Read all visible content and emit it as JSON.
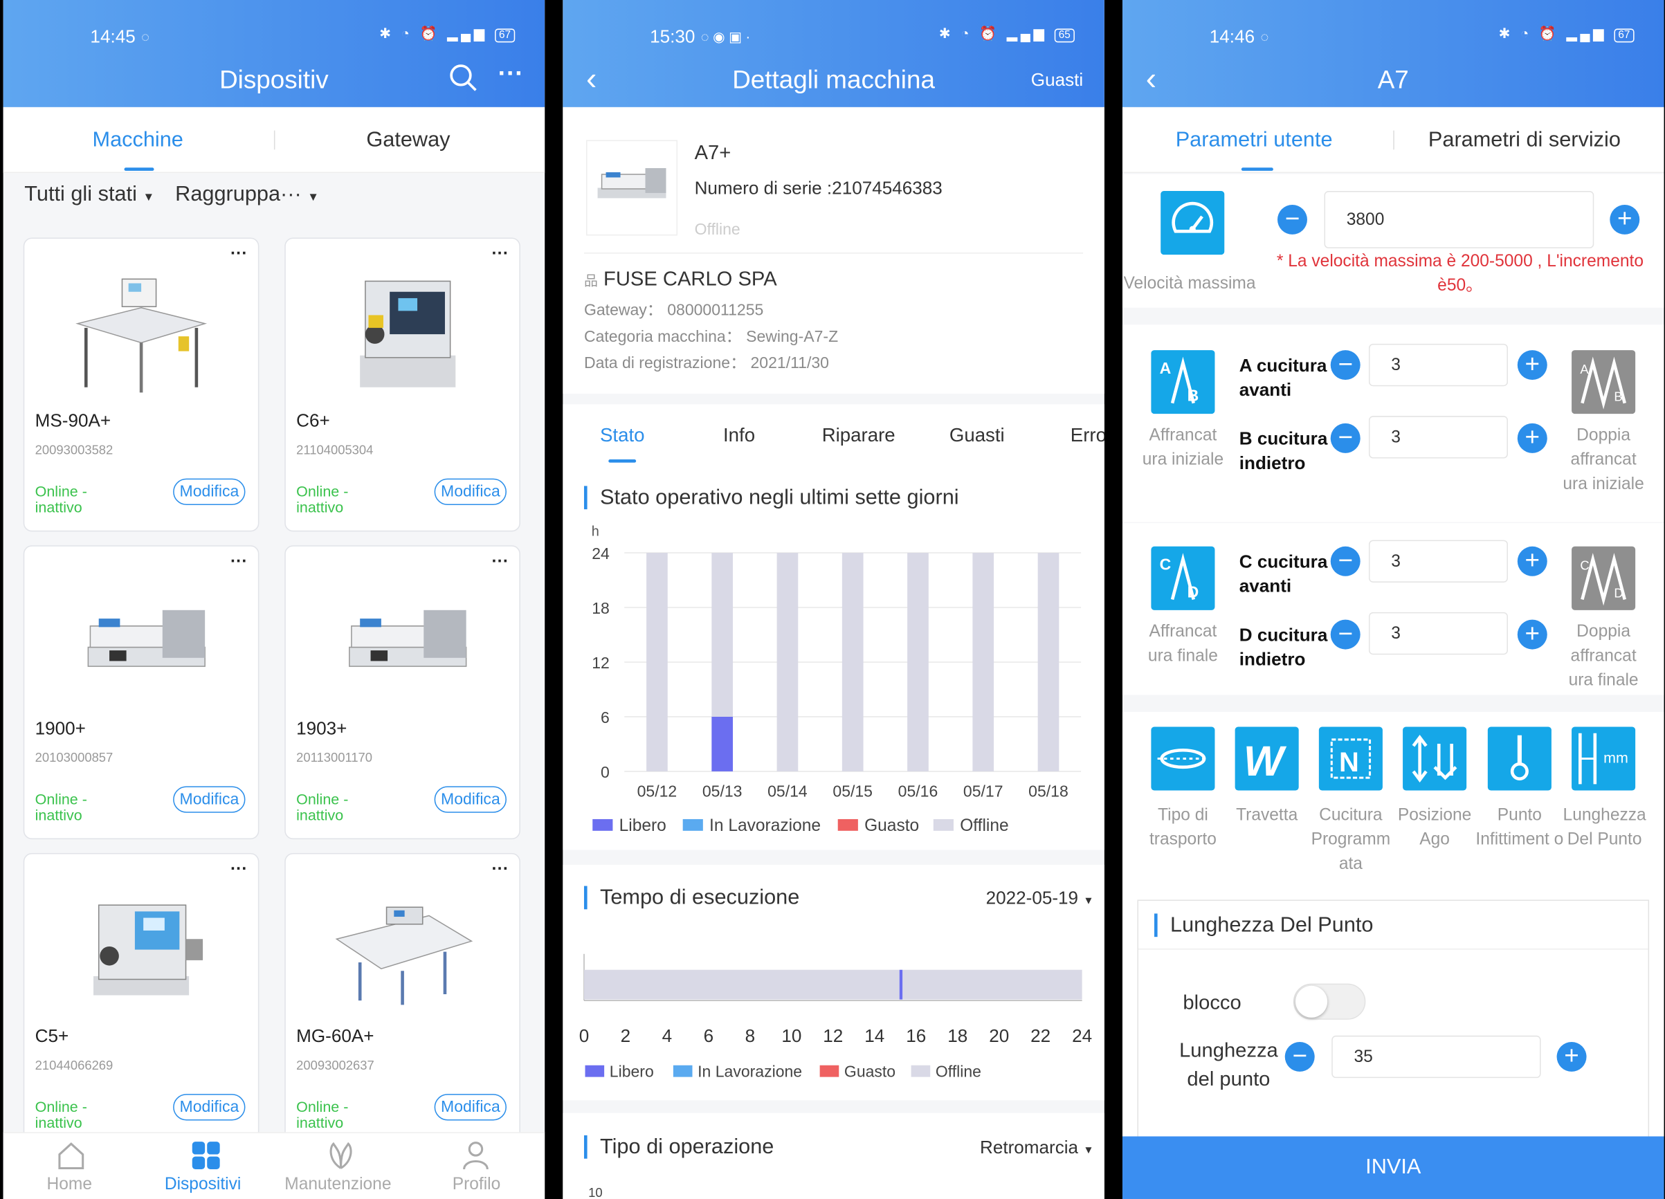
{
  "p1": {
    "time": "14:45",
    "battery": "67",
    "title": "Dispositiv",
    "tabs": [
      "Macchine",
      "Gateway"
    ],
    "filters": [
      "Tutti gli stati",
      "Raggruppa···"
    ],
    "cards": [
      {
        "name": "MS-90A+",
        "serial": "20093003582",
        "status": "Online - inattivo",
        "edit": "Modifica"
      },
      {
        "name": "C6+",
        "serial": "21104005304",
        "status": "Online - inattivo",
        "edit": "Modifica"
      },
      {
        "name": "1900+",
        "serial": "20103000857",
        "status": "Online - inattivo",
        "edit": "Modifica"
      },
      {
        "name": "1903+",
        "serial": "20113001170",
        "status": "Online - inattivo",
        "edit": "Modifica"
      },
      {
        "name": "C5+",
        "serial": "21044066269",
        "status": "Online - inattivo",
        "edit": "Modifica"
      },
      {
        "name": "MG-60A+",
        "serial": "20093002637",
        "status": "Online - inattivo",
        "edit": "Modifica"
      }
    ],
    "nav": [
      "Home",
      "Dispositivi",
      "Manutenzione",
      "Profilo"
    ]
  },
  "p2": {
    "time": "15:30",
    "battery": "65",
    "title": "Dettagli macchina",
    "right": "Guasti",
    "model": "A7+",
    "serial": "Numero di serie :21074546383",
    "state": "Offline",
    "company": "FUSE CARLO SPA",
    "gateway": "Gateway： 08000011255",
    "category": "Categoria macchina： Sewing-A7-Z",
    "regdate": "Data di registrazione： 2021/11/30",
    "tabs": [
      "Stato",
      "Info",
      "Riparare",
      "Guasti",
      "Erro"
    ],
    "sec1": "Stato operativo negli ultimi sette giorni",
    "sec2": "Tempo di esecuzione",
    "date": "2022-05-19",
    "sec3": "Tipo di operazione",
    "optype": "Retromarcia",
    "bottom_tick": "10",
    "legend": [
      "Libero",
      "In Lavorazione",
      "Guasto",
      "Offline"
    ],
    "colors": {
      "libero": "#6b6ef0",
      "lavorazione": "#5aaaf0",
      "guasto": "#ef6161",
      "offline": "#d9d9e6"
    }
  },
  "chart_data": [
    {
      "type": "bar",
      "ylabel": "h",
      "ylim": [
        0,
        24
      ],
      "yticks": [
        "0",
        "6",
        "12",
        "18",
        "24"
      ],
      "categories": [
        "05/12",
        "05/13",
        "05/14",
        "05/15",
        "05/16",
        "05/17",
        "05/18"
      ],
      "series": [
        {
          "name": "Libero",
          "values": [
            0,
            6,
            0,
            0,
            0,
            0,
            0
          ]
        },
        {
          "name": "In Lavorazione",
          "values": [
            0,
            0,
            0,
            0,
            0,
            0,
            0
          ]
        },
        {
          "name": "Guasto",
          "values": [
            0,
            0,
            0,
            0,
            0,
            0,
            0
          ]
        },
        {
          "name": "Offline",
          "values": [
            24,
            18,
            24,
            24,
            24,
            24,
            24
          ]
        }
      ]
    },
    {
      "type": "bar",
      "xlim": [
        0,
        24
      ],
      "xticks": [
        "0",
        "2",
        "4",
        "6",
        "8",
        "10",
        "12",
        "14",
        "16",
        "18",
        "20",
        "22",
        "24"
      ],
      "segments": [
        {
          "series": "Offline",
          "start": 0,
          "end": 15.2
        },
        {
          "series": "Libero",
          "start": 15.2,
          "end": 15.35
        },
        {
          "series": "Offline",
          "start": 15.35,
          "end": 24
        }
      ]
    }
  ],
  "p3": {
    "time": "14:46",
    "battery": "67",
    "title": "A7",
    "tabs": [
      "Parametri utente",
      "Parametri di servizio"
    ],
    "speed_label": "Velocità massima",
    "speed": "3800",
    "speed_note": "* La velocità massima è 200-5000 , L'incremento è50。",
    "a_label": "A cucitura avanti",
    "a": "3",
    "b_label": "B cucitura indietro",
    "b": "3",
    "c_label": "C cucitura avanti",
    "c": "3",
    "d_label": "D cucitura indietro",
    "d": "3",
    "start_label": "Affrancat ura iniziale",
    "dstart_label": "Doppia affrancat ura iniziale",
    "end_label": "Affrancat ura finale",
    "dend_label": "Doppia affrancat ura finale",
    "icons": [
      "Tipo di trasporto",
      "Travetta",
      "Cucitura Programm ata",
      "Posizione Ago",
      "Punto Infittiment o",
      "Lunghezza Del Punto"
    ],
    "stitch_title": "Lunghezza Del Punto",
    "lock": "blocco",
    "len_label": "Lunghezza del punto",
    "len": "35",
    "submit": "INVIA"
  }
}
